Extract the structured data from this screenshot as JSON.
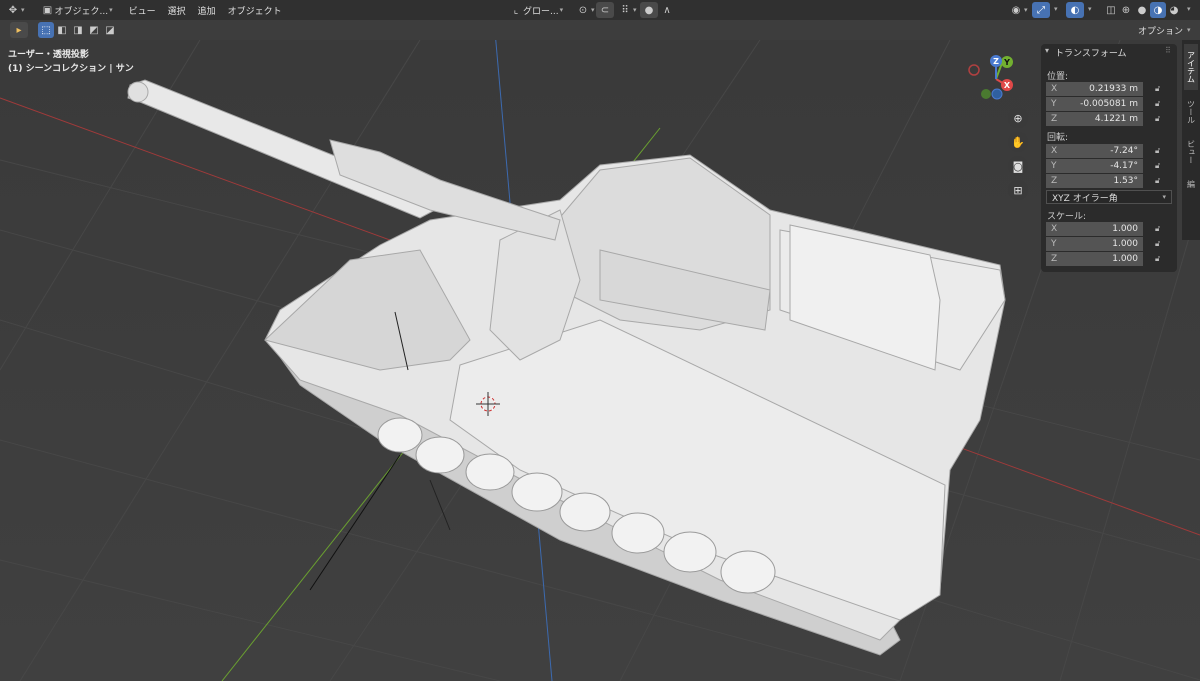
{
  "header": {
    "mode_label": "オブジェク...",
    "menus": [
      "ビュー",
      "選択",
      "追加",
      "オブジェクト"
    ],
    "transform_orientation": "グロー..."
  },
  "toolbar": {
    "options_label": "オプション"
  },
  "viewport": {
    "line1": "ユーザー・透視投影",
    "line2": "(1) シーンコレクション | サン",
    "axis_x": "X",
    "axis_y": "Y",
    "axis_z": "Z"
  },
  "npanel": {
    "title": "トランスフォーム",
    "location_label": "位置:",
    "location": [
      {
        "axis": "X",
        "value": "0.21933 m"
      },
      {
        "axis": "Y",
        "value": "-0.005081 m"
      },
      {
        "axis": "Z",
        "value": "4.1221 m"
      }
    ],
    "rotation_label": "回転:",
    "rotation": [
      {
        "axis": "X",
        "value": "-7.24°"
      },
      {
        "axis": "Y",
        "value": "-4.17°"
      },
      {
        "axis": "Z",
        "value": "1.53°"
      }
    ],
    "rotation_mode": "XYZ オイラー角",
    "scale_label": "スケール:",
    "scale": [
      {
        "axis": "X",
        "value": "1.000"
      },
      {
        "axis": "Y",
        "value": "1.000"
      },
      {
        "axis": "Z",
        "value": "1.000"
      }
    ]
  },
  "sidetabs": [
    "アイテム",
    "ツール",
    "ビュー",
    "編"
  ]
}
